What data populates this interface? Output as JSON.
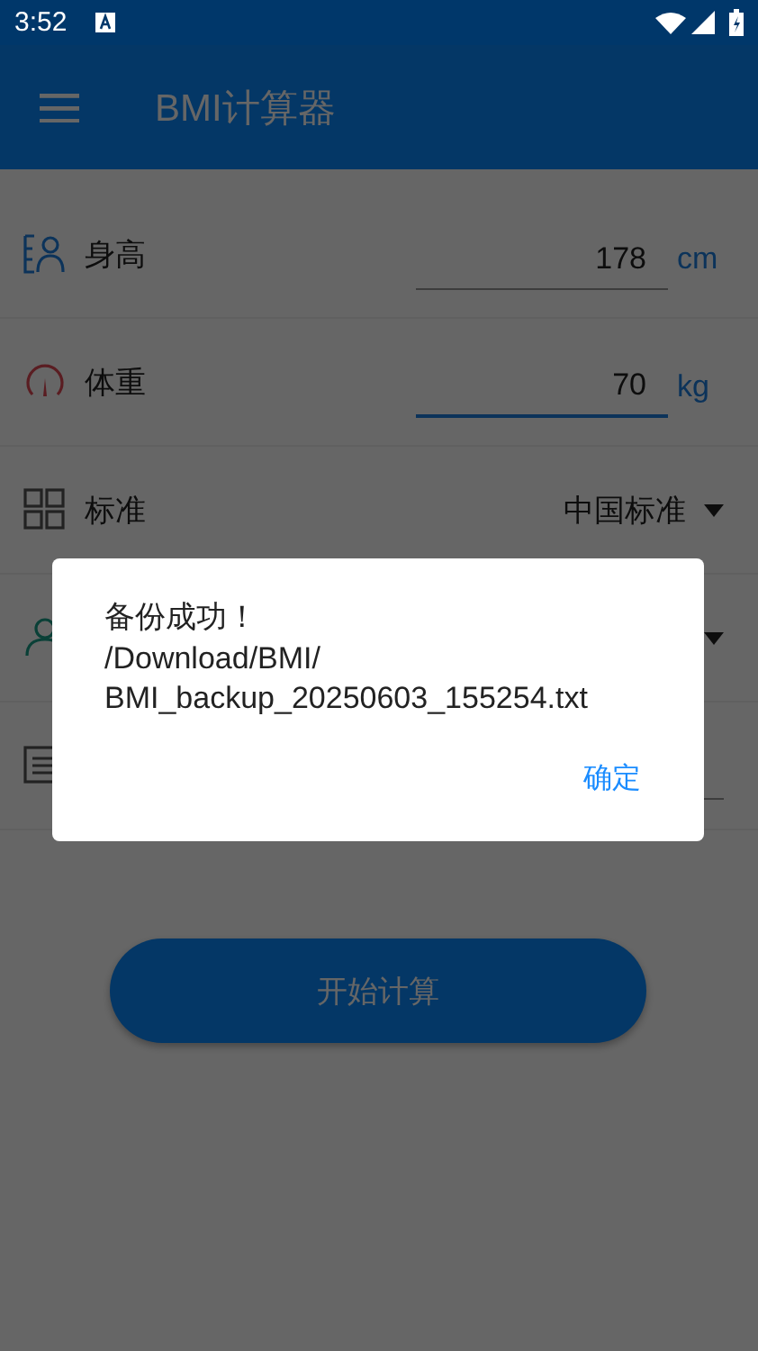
{
  "status_bar": {
    "time": "3:52"
  },
  "app_bar": {
    "title": "BMI计算器"
  },
  "form": {
    "rows": [
      {
        "kind": "input",
        "label": "身高",
        "value": "178",
        "unit": "cm",
        "focused": false
      },
      {
        "kind": "input",
        "label": "体重",
        "value": "70",
        "unit": "kg",
        "focused": true
      },
      {
        "kind": "select",
        "label": "标准",
        "value": "中国标准"
      },
      {
        "kind": "select"
      },
      {
        "kind": "input"
      }
    ]
  },
  "calculate_button": {
    "label": "开始计算"
  },
  "dialog": {
    "lines": [
      "备份成功！",
      "/Download/BMI/",
      "BMI_backup_20250603_155254.txt"
    ],
    "button": "确定"
  }
}
